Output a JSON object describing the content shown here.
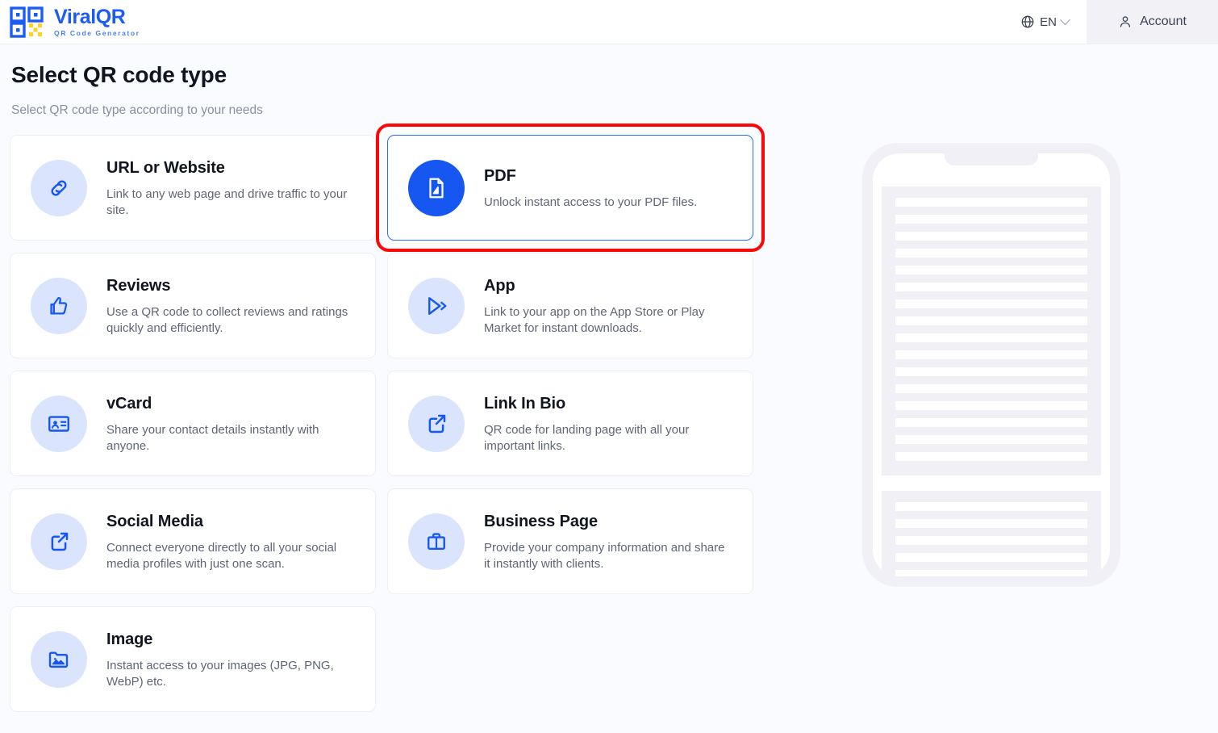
{
  "header": {
    "brand_name": "ViralQR",
    "brand_tagline": "QR Code Generator",
    "language": "EN",
    "account_label": "Account"
  },
  "page": {
    "title": "Select QR code type",
    "subtitle": "Select QR code type according to your needs"
  },
  "colors": {
    "brand_blue": "#1a5cf5",
    "icon_circle_bg": "#dbe4fd",
    "selected_border": "#2f6ef0",
    "highlight_red": "#fb0707",
    "page_bg": "#fafbfe",
    "card_bg": "#ffffff",
    "skeleton_grey": "#f0f0f6"
  },
  "cards": [
    {
      "title": "URL or Website",
      "desc": "Link to any web page and drive traffic to your site.",
      "icon": "link-chain-icon",
      "selected": false,
      "highlighted": false
    },
    {
      "title": "PDF",
      "desc": "Unlock instant access to your PDF files.",
      "icon": "pdf-document-icon",
      "selected": true,
      "highlighted": true
    },
    {
      "title": "Reviews",
      "desc": "Use a QR code to collect reviews and ratings quickly and efficiently.",
      "icon": "thumbs-up-icon",
      "selected": false,
      "highlighted": false
    },
    {
      "title": "App",
      "desc": "Link to your app on the App Store or Play Market for instant downloads.",
      "icon": "play-store-icon",
      "selected": false,
      "highlighted": false
    },
    {
      "title": "vCard",
      "desc": "Share your contact details instantly with anyone.",
      "icon": "contact-card-icon",
      "selected": false,
      "highlighted": false
    },
    {
      "title": "Link In Bio",
      "desc": "QR code for landing page with all your important links.",
      "icon": "external-link-icon",
      "selected": false,
      "highlighted": false
    },
    {
      "title": "Social Media",
      "desc": "Connect everyone directly to all your social media profiles with just one scan.",
      "icon": "external-link-icon",
      "selected": false,
      "highlighted": false
    },
    {
      "title": "Business Page",
      "desc": "Provide your company information and share it instantly with clients.",
      "icon": "briefcase-icon",
      "selected": false,
      "highlighted": false
    },
    {
      "title": "Image",
      "desc": "Instant access to your images (JPG, PNG, WebP) etc.",
      "icon": "image-folder-icon",
      "selected": false,
      "highlighted": false
    }
  ],
  "preview": {
    "type": "phone-skeleton-mockup",
    "block_one_lines": 16,
    "block_two_lines": 5
  }
}
